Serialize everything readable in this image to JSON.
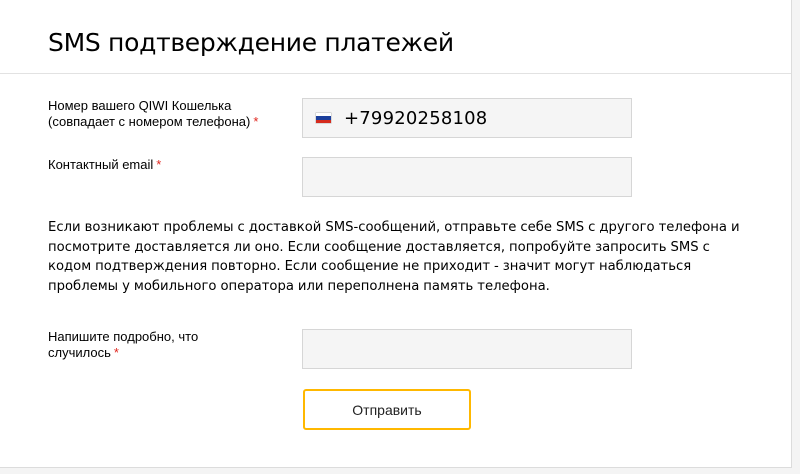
{
  "header": {
    "title": "SMS подтверждение платежей"
  },
  "form": {
    "wallet": {
      "label_line1": "Номер вашего QIWI Кошелька",
      "label_line2": "(совпадает с номером телефона)",
      "required_mark": "*",
      "country_flag": "russia-flag-icon",
      "value": "+79920258108"
    },
    "email": {
      "label": "Контактный email",
      "required_mark": "*",
      "value": ""
    },
    "info_text": "Если возникают проблемы с доставкой SMS-сообщений, отправьте себе SMS с другого телефона и посмотрите доставляется ли оно. Если сообщение доставляется, попробуйте запросить SMS с кодом подтверждения повторно. Если сообщение не приходит - значит могут наблюдаться проблемы у мобильного оператора или переполнена память телефона.",
    "description": {
      "label_line1": "Напишите подробно, что",
      "label_line2": "случилось",
      "required_mark": "*",
      "value": ""
    },
    "submit_label": "Отправить"
  },
  "colors": {
    "required": "#e0261e",
    "button_border": "#ffb800",
    "field_background": "#f5f5f5",
    "field_border": "#d6d6d6"
  }
}
